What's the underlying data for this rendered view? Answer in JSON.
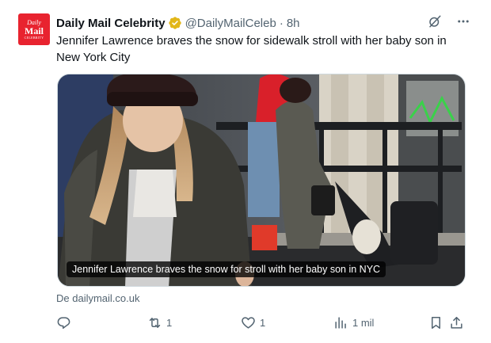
{
  "account": {
    "avatar_line1": "Daily",
    "avatar_line2": "Mail",
    "avatar_line3": "CELEBRITY",
    "name": "Daily Mail Celebrity",
    "handle": "@DailyMailCeleb",
    "separator": "·",
    "time": "8h"
  },
  "tweet": {
    "text": "Jennifer Lawrence braves the snow for sidewalk stroll with her baby son in New York City"
  },
  "media": {
    "caption": "Jennifer Lawrence braves the snow for stroll with her baby son in NYC"
  },
  "source": "De dailymail.co.uk",
  "actions": {
    "reposts": "1",
    "likes": "1",
    "views": "1 mil"
  },
  "icons": {
    "verified": "verified-badge-icon",
    "grok": "grok-icon",
    "more": "more-icon",
    "reply": "reply-icon",
    "repost": "repost-icon",
    "like": "heart-icon",
    "views": "views-icon",
    "bookmark": "bookmark-icon",
    "share": "share-icon"
  },
  "colors": {
    "brand": "#e8232f",
    "verified": "#e2b719",
    "text": "#0f1419",
    "secondary": "#536471"
  }
}
